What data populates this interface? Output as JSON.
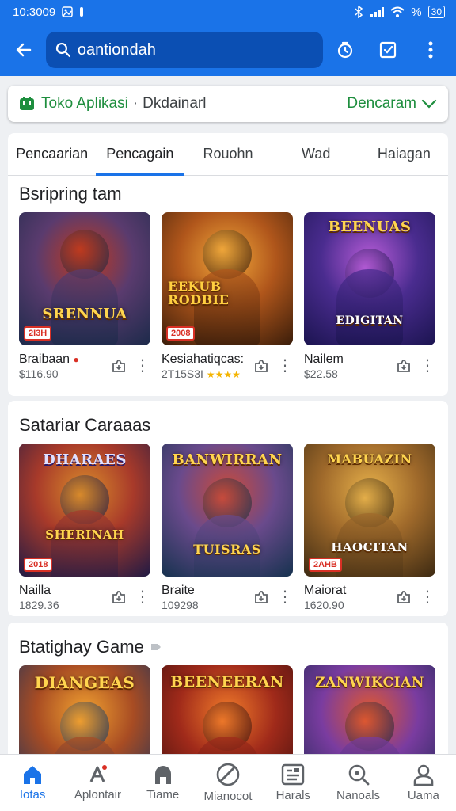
{
  "status_bar": {
    "time": "10:3009",
    "battery": "30"
  },
  "search": {
    "query": "oantiondah",
    "placeholder": ""
  },
  "store": {
    "name": "Toko Aplikasi",
    "subtitle": "Dkdainarl",
    "action": "Dencaram"
  },
  "tabs": [
    {
      "label": "Pencaarian",
      "active": false
    },
    {
      "label": "Pencagain",
      "active": true
    },
    {
      "label": "Rouohn",
      "active": false
    },
    {
      "label": "Wad",
      "active": false
    },
    {
      "label": "Haiagan",
      "active": false
    }
  ],
  "sections": [
    {
      "title": "Bsripring tam",
      "games": [
        {
          "name": "Braibaan",
          "price": "$116.90",
          "art": "SRENNUA",
          "badge": "2I3H",
          "colors": [
            "#1c2a4a",
            "#5a3b6e",
            "#c23a1c"
          ]
        },
        {
          "name": "Kesiahatiqcas:",
          "price": "2T15S3I",
          "stars": "★★★★",
          "art": "EEKUB RODBIE",
          "badge": "2008",
          "colors": [
            "#3a1d0a",
            "#b0561b",
            "#f2a93b"
          ]
        },
        {
          "name": "Nailem",
          "price": "$22.58",
          "art": "BEENUAS",
          "caption": "EDIGITAN",
          "colors": [
            "#1b1450",
            "#4a2c8f",
            "#b55bd6"
          ]
        }
      ]
    },
    {
      "title": "Satariar Caraaas",
      "games": [
        {
          "name": "Nailla",
          "price": "1829.36",
          "art": "DHARAES",
          "caption": "SHERINAH",
          "badge": "2018",
          "colors": [
            "#201a44",
            "#a83a2a",
            "#d98b2b"
          ]
        },
        {
          "name": "Braite",
          "price": "109298",
          "art": "BANWIRRAN",
          "caption": "TUISRAS",
          "colors": [
            "#16324f",
            "#6a4a8c",
            "#c94b3a"
          ]
        },
        {
          "name": "Maiorat",
          "price": "1620.90",
          "art": "MABUAZIN",
          "caption": "HAOCITAN",
          "badge": "2AHB",
          "colors": [
            "#3d2a12",
            "#a06a2b",
            "#e6b04a"
          ]
        }
      ]
    },
    {
      "title": "Btatighay Game",
      "games": [
        {
          "art": "DIANGEAS",
          "colors": [
            "#14305e",
            "#a84c23",
            "#f0a030"
          ]
        },
        {
          "art": "BEENEERAN",
          "colors": [
            "#3a0d0d",
            "#a02a1a",
            "#f07a2a"
          ]
        },
        {
          "art": "ZANWIKCIAN",
          "colors": [
            "#1d2752",
            "#7a3ca0",
            "#e0582e"
          ]
        }
      ]
    }
  ],
  "bottom_nav": [
    {
      "label": "Iotas",
      "icon": "home-icon",
      "active": true
    },
    {
      "label": "Aplontair",
      "icon": "apps-icon",
      "active": false
    },
    {
      "label": "Tiame",
      "icon": "games-icon",
      "active": false
    },
    {
      "label": "Mianocot",
      "icon": "movies-icon",
      "active": false
    },
    {
      "label": "Harals",
      "icon": "books-icon",
      "active": false
    },
    {
      "label": "Nanoals",
      "icon": "search-icon",
      "active": false
    },
    {
      "label": "Uama",
      "icon": "account-icon",
      "active": false
    }
  ],
  "colors": {
    "accent": "#1a73e8",
    "brand_green": "#1e8e3e"
  }
}
